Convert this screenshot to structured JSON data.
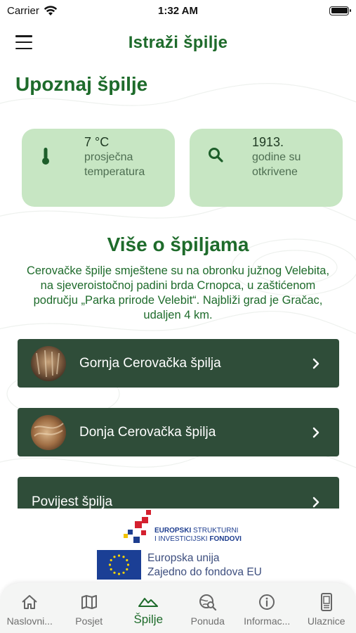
{
  "status_bar": {
    "carrier": "Carrier",
    "time": "1:32 AM"
  },
  "header": {
    "title": "Istraži špilje",
    "menu_icon": "hamburger-menu-icon"
  },
  "section_title": "Upoznaj špilje",
  "stats": [
    {
      "value": "7 °C",
      "label_line1": "prosječna",
      "label_line2": "temperatura",
      "icon": "thermometer-icon"
    },
    {
      "value": "1913.",
      "label_line1": "godine su",
      "label_line2": "otkrivene",
      "icon": "search-icon"
    }
  ],
  "more": {
    "title": "Više o špiljama",
    "line1": "Cerovačke špilje smještene su na obronku južnog Velebita,",
    "line2": "na sjeveroistočnoj padini brda Crnopca, u zaštićenom",
    "line3": "području „Parka prirode Velebit“. Najbliži grad je Gračac,",
    "line4": "udaljen 4 km."
  },
  "list": [
    {
      "label": "Gornja Cerovačka špilja",
      "icon": "chevron-right-icon"
    },
    {
      "label": "Donja Cerovačka špilja",
      "icon": "chevron-right-icon"
    },
    {
      "label": "Povijest špilja",
      "icon": "chevron-right-icon"
    }
  ],
  "funding": {
    "esif_line1_bold": "EUROPSKI",
    "esif_line1_rest": " STRUKTURNI",
    "esif_line2_bold": "I INVESTICIJSKI",
    "esif_line2_rest": " FONDOVI",
    "eu_line1": "Europska unija",
    "eu_line2": "Zajedno do fondova EU"
  },
  "tabs": [
    {
      "label": "Naslovni...",
      "icon": "home-icon",
      "active": false
    },
    {
      "label": "Posjet",
      "icon": "map-icon",
      "active": false
    },
    {
      "label": "Špilje",
      "icon": "mountains-icon",
      "active": true
    },
    {
      "label": "Ponuda",
      "icon": "globe-search-icon",
      "active": false
    },
    {
      "label": "Informac...",
      "icon": "info-icon",
      "active": false
    },
    {
      "label": "Ulaznice",
      "icon": "ticket-phone-icon",
      "active": false
    }
  ],
  "colors": {
    "brand_green": "#1e6b2b",
    "card_bg": "#c7e6c3",
    "list_bg": "#2f4d39",
    "tab_bar_bg": "#f4f5f4"
  }
}
